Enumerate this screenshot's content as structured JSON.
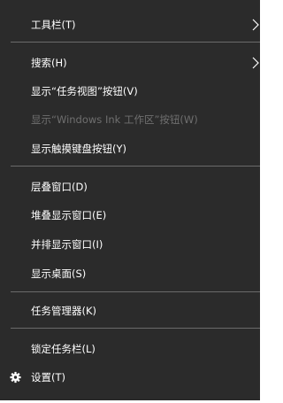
{
  "menu": {
    "toolbar": "工具栏(T)",
    "search": "搜索(H)",
    "show_task_view": "显示“任务视图”按钮(V)",
    "show_ink_workspace": "显示“Windows Ink 工作区”按钮(W)",
    "show_touch_keyboard": "显示触摸键盘按钮(Y)",
    "cascade_windows": "层叠窗口(D)",
    "stack_windows": "堆叠显示窗口(E)",
    "side_by_side_windows": "并排显示窗口(I)",
    "show_desktop": "显示桌面(S)",
    "task_manager": "任务管理器(K)",
    "lock_taskbar": "锁定任务栏(L)",
    "settings": "设置(T)"
  },
  "colors": {
    "menu_background": "#2b2b2b",
    "text": "#ffffff",
    "disabled_text": "#6f6f6f",
    "separator": "#6a6a6a"
  },
  "icons": {
    "submenu_arrow": "chevron-right-icon",
    "settings": "gear-icon"
  }
}
